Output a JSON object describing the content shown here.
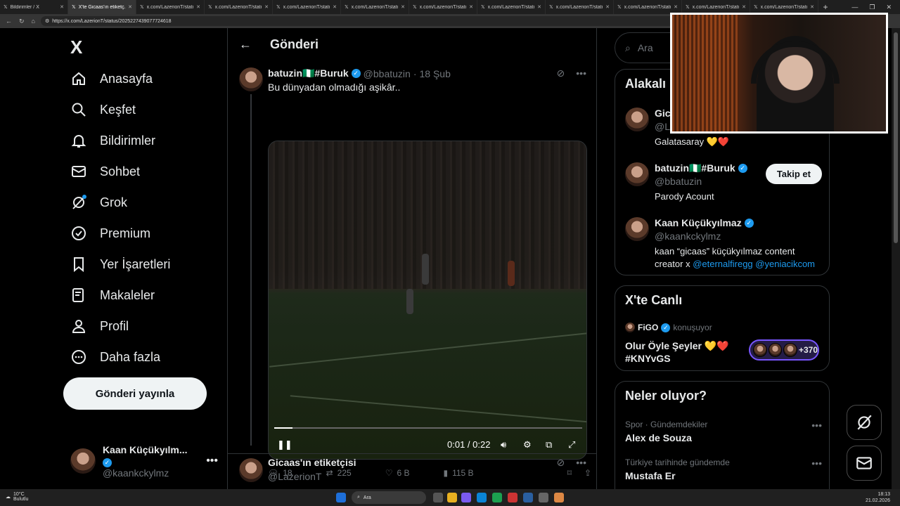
{
  "browser": {
    "tabs": [
      {
        "label": "Bildirimler / X",
        "active": false
      },
      {
        "label": "X'te Gicaas'ın etiketç...",
        "active": true
      },
      {
        "label": "x.com/LazerionT/status/20...",
        "active": false
      },
      {
        "label": "x.com/LazerionT/status/20...",
        "active": false
      },
      {
        "label": "x.com/LazerionT/status/20...",
        "active": false
      },
      {
        "label": "x.com/LazerionT/status/20...",
        "active": false
      },
      {
        "label": "x.com/LazerionT/status/20...",
        "active": false
      },
      {
        "label": "x.com/LazerionT/status/20...",
        "active": false
      },
      {
        "label": "x.com/LazerionT/status/20...",
        "active": false
      },
      {
        "label": "x.com/LazerionT/status/20...",
        "active": false
      },
      {
        "label": "x.com/LazerionT/status/20...",
        "active": false
      },
      {
        "label": "x.com/LazerionT/status/20...",
        "active": false
      }
    ],
    "url": "https://x.com/LazerionT/status/2025227439077724618"
  },
  "nav": {
    "logo": "X",
    "items": [
      {
        "label": "Anasayfa",
        "icon": "home-icon"
      },
      {
        "label": "Keşfet",
        "icon": "search-icon"
      },
      {
        "label": "Bildirimler",
        "icon": "bell-icon"
      },
      {
        "label": "Sohbet",
        "icon": "mail-icon"
      },
      {
        "label": "Grok",
        "icon": "grok-icon"
      },
      {
        "label": "Premium",
        "icon": "verified-icon"
      },
      {
        "label": "Yer İşaretleri",
        "icon": "bookmark-icon"
      },
      {
        "label": "Makaleler",
        "icon": "article-icon"
      },
      {
        "label": "Profil",
        "icon": "person-icon"
      },
      {
        "label": "Daha fazla",
        "icon": "more-circle-icon"
      }
    ],
    "post_button": "Gönderi yayınla",
    "account": {
      "name": "Kaan Küçükyılm...",
      "handle": "@kaankckylmz"
    }
  },
  "main": {
    "title": "Gönderi",
    "tweet": {
      "name": "batuzin🇳🇬#Buruk",
      "handle": "@bbatuzin",
      "time": "18 Şub",
      "text": "Bu dünyadan olmadığı aşikâr..",
      "video": {
        "time": "0:01 / 0:22",
        "progress": 0.06
      },
      "actions": {
        "replies": "18",
        "reposts": "225",
        "likes": "6 B",
        "views": "115 B"
      }
    },
    "reply": {
      "name": "Gicaas'ın etiketçisi",
      "handle": "@LazerionT"
    }
  },
  "sidebar": {
    "search_placeholder": "Ara",
    "related": {
      "title": "Alakalı",
      "accounts": [
        {
          "name": "Gic",
          "handle": "@L",
          "bio": "Galatasaray 💛❤️",
          "verified": false
        },
        {
          "name": "batuzin🇳🇬#Buruk",
          "handle": "@bbatuzin",
          "bio": "Parody Acount",
          "verified": true,
          "follow": "Takip et"
        },
        {
          "name": "Kaan Küçükyılmaz",
          "handle": "@kaankckylmz",
          "bio_prefix": "kaan “gicaas” küçükyılmaz content creator x ",
          "bio_link1": "@eternalfiregg",
          "bio_link2": "@yeniacikcom",
          "verified": true
        }
      ]
    },
    "live": {
      "title": "X'te Canlı",
      "host": "FiGO",
      "status": "konuşuyor",
      "space_title_line1": "Olur Öyle Şeyler 💛❤️",
      "space_title_line2": "#KNYvGS",
      "listeners": "+370"
    },
    "trends": {
      "title": "Neler oluyor?",
      "items": [
        {
          "context": "Spor · Gündemdekiler",
          "name": "Alex de Souza"
        },
        {
          "context": "Türkiye tarihinde gündemde",
          "name": "Mustafa Er"
        }
      ]
    }
  },
  "taskbar": {
    "weather_temp": "10°C",
    "weather_desc": "Bulutlu",
    "search": "Ara",
    "time": "18:13",
    "date": "21.02.2026"
  },
  "colors": {
    "accent": "#1d9bf0",
    "background": "#000000",
    "border": "#2f3336",
    "muted": "#71767b"
  }
}
